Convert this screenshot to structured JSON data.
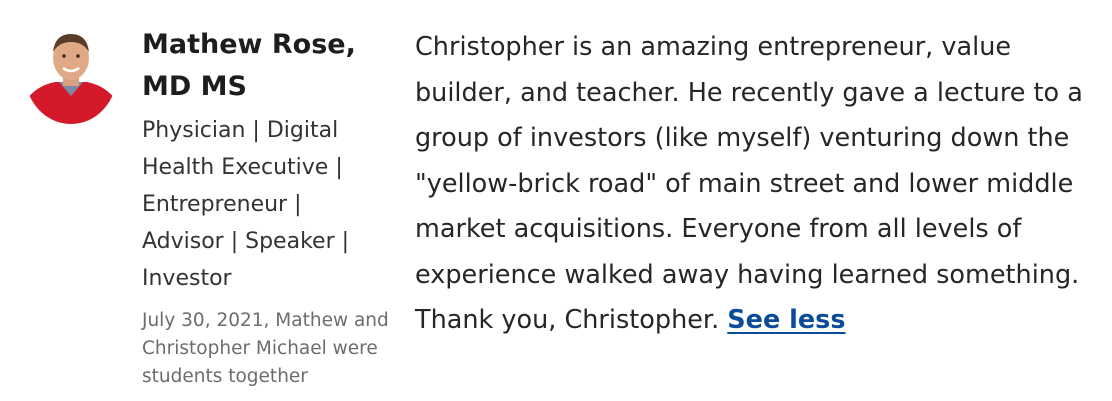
{
  "recommendation": {
    "author": {
      "name": "Mathew Rose, MD MS",
      "headline": "Physician | Digital Health Executive | Entrepreneur | Advisor | Speaker | Investor",
      "meta": "July 30, 2021, Mathew and Christopher Michael were students together",
      "avatar_icon": "person-photo"
    },
    "text": "Christopher is an amazing entrepreneur, value builder, and teacher. He recently gave a lecture to a group of investors (like myself) venturing down the \"yellow-brick road\" of main street and lower middle market acquisitions. Everyone from all levels of experience walked away having learned something. Thank you, Christopher. ",
    "see_less_label": "See less"
  },
  "colors": {
    "link": "#0a4c99",
    "avatar_sweater": "#d4192a",
    "meta_text": "#6c6c6c"
  }
}
